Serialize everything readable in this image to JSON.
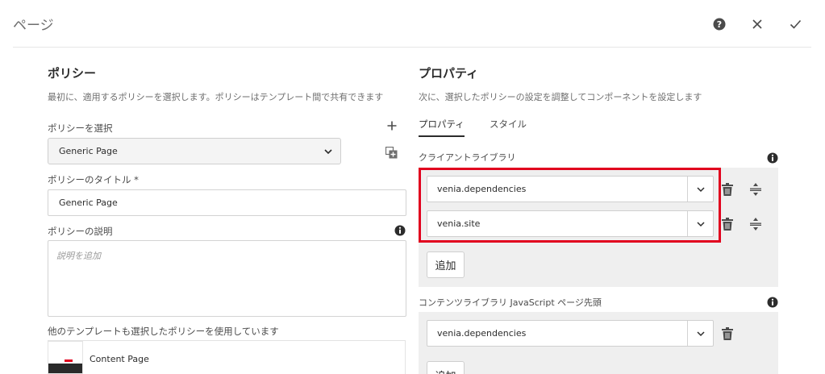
{
  "dialog": {
    "title": "ページ",
    "help_icon": "help-circle-icon",
    "close_icon": "close-icon",
    "done_icon": "checkmark-icon"
  },
  "policy": {
    "title": "ポリシー",
    "description": "最初に、適用するポリシーを選択します。ポリシーはテンプレート間で共有できます",
    "select_label": "ポリシーを選択",
    "selected_policy": "Generic Page",
    "policy_title_label": "ポリシーのタイトル *",
    "policy_title_value": "Generic Page",
    "description_label": "ポリシーの説明",
    "description_placeholder": "説明を追加",
    "shared_label": "他のテンプレートも選択したポリシーを使用しています",
    "shared_templates": [
      "Content Page"
    ]
  },
  "properties": {
    "title": "プロパティ",
    "description": "次に、選択したポリシーの設定を調整してコンポーネントを設定します",
    "tabs": [
      "プロパティ",
      "スタイル"
    ],
    "client_libs_label": "クライアントライブラリ",
    "client_libs": [
      "venia.dependencies",
      "venia.site"
    ],
    "add_label": "追加",
    "content_libs_label": "コンテンツライブラリ JavaScript ページ先頭",
    "content_libs": [
      "venia.dependencies"
    ]
  },
  "colors": {
    "highlight": "#e1001e",
    "panel": "#efefef"
  }
}
